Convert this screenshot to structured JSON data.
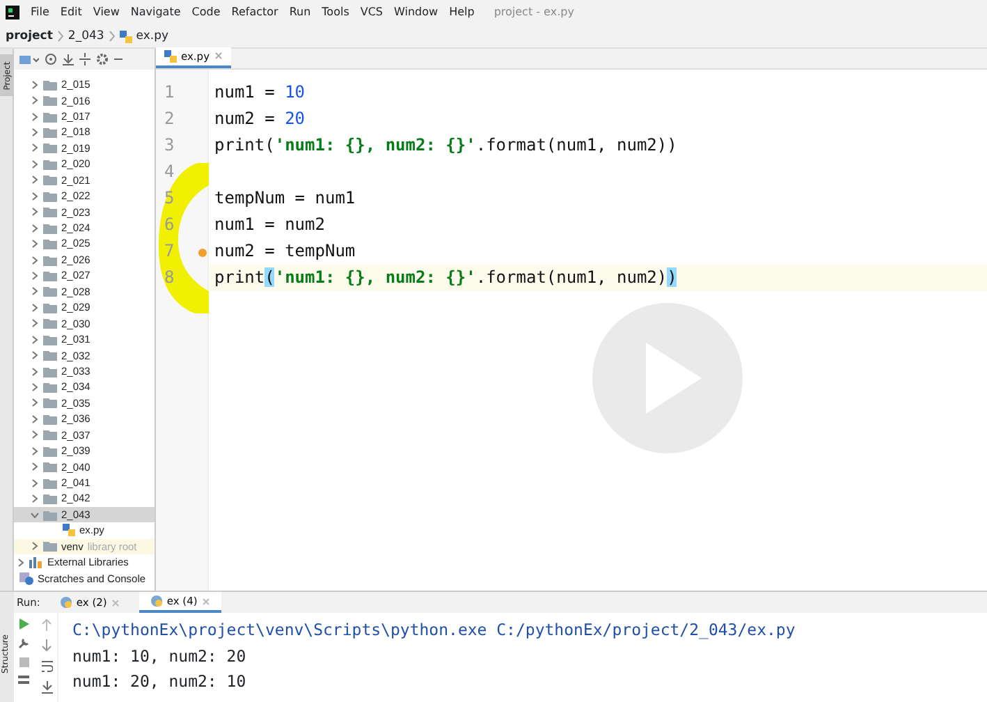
{
  "window": {
    "title": "project - ex.py"
  },
  "menu": [
    "File",
    "Edit",
    "View",
    "Navigate",
    "Code",
    "Refactor",
    "Run",
    "Tools",
    "VCS",
    "Window",
    "Help"
  ],
  "breadcrumbs": [
    {
      "label": "project",
      "kind": "project"
    },
    {
      "label": "2_043",
      "kind": "folder"
    },
    {
      "label": "ex.py",
      "kind": "file"
    }
  ],
  "side_stripe": {
    "label": "Project"
  },
  "tree": [
    {
      "label": "2_015",
      "kind": "folder",
      "expanded": false,
      "selected": false
    },
    {
      "label": "2_016",
      "kind": "folder",
      "expanded": false,
      "selected": false
    },
    {
      "label": "2_017",
      "kind": "folder",
      "expanded": false,
      "selected": false
    },
    {
      "label": "2_018",
      "kind": "folder",
      "expanded": false,
      "selected": false
    },
    {
      "label": "2_019",
      "kind": "folder",
      "expanded": false,
      "selected": false
    },
    {
      "label": "2_020",
      "kind": "folder",
      "expanded": false,
      "selected": false
    },
    {
      "label": "2_021",
      "kind": "folder",
      "expanded": false,
      "selected": false
    },
    {
      "label": "2_022",
      "kind": "folder",
      "expanded": false,
      "selected": false
    },
    {
      "label": "2_023",
      "kind": "folder",
      "expanded": false,
      "selected": false
    },
    {
      "label": "2_024",
      "kind": "folder",
      "expanded": false,
      "selected": false
    },
    {
      "label": "2_025",
      "kind": "folder",
      "expanded": false,
      "selected": false
    },
    {
      "label": "2_026",
      "kind": "folder",
      "expanded": false,
      "selected": false
    },
    {
      "label": "2_027",
      "kind": "folder",
      "expanded": false,
      "selected": false
    },
    {
      "label": "2_028",
      "kind": "folder",
      "expanded": false,
      "selected": false
    },
    {
      "label": "2_029",
      "kind": "folder",
      "expanded": false,
      "selected": false
    },
    {
      "label": "2_030",
      "kind": "folder",
      "expanded": false,
      "selected": false
    },
    {
      "label": "2_031",
      "kind": "folder",
      "expanded": false,
      "selected": false
    },
    {
      "label": "2_032",
      "kind": "folder",
      "expanded": false,
      "selected": false
    },
    {
      "label": "2_033",
      "kind": "folder",
      "expanded": false,
      "selected": false
    },
    {
      "label": "2_034",
      "kind": "folder",
      "expanded": false,
      "selected": false
    },
    {
      "label": "2_035",
      "kind": "folder",
      "expanded": false,
      "selected": false
    },
    {
      "label": "2_036",
      "kind": "folder",
      "expanded": false,
      "selected": false
    },
    {
      "label": "2_037",
      "kind": "folder",
      "expanded": false,
      "selected": false
    },
    {
      "label": "2_039",
      "kind": "folder",
      "expanded": false,
      "selected": false
    },
    {
      "label": "2_040",
      "kind": "folder",
      "expanded": false,
      "selected": false
    },
    {
      "label": "2_041",
      "kind": "folder",
      "expanded": false,
      "selected": false
    },
    {
      "label": "2_042",
      "kind": "folder",
      "expanded": false,
      "selected": false
    },
    {
      "label": "2_043",
      "kind": "folder",
      "expanded": true,
      "selected": true,
      "children": [
        {
          "label": "ex.py",
          "kind": "file",
          "selected": false
        }
      ]
    },
    {
      "label": "venv",
      "note": "library root",
      "kind": "folder",
      "expanded": false,
      "selected": false
    },
    {
      "label": "External Libraries",
      "kind": "library",
      "expanded": false,
      "selected": false,
      "outer": true
    },
    {
      "label": "Scratches and Console",
      "kind": "scratches",
      "selected": false,
      "outer": true
    }
  ],
  "editor": {
    "tabs": [
      {
        "label": "ex.py",
        "selected": true
      }
    ],
    "lines": [
      {
        "number": "1",
        "current": false,
        "tokens": [
          {
            "text": "num1 = ",
            "kind": "plain"
          },
          {
            "text": "10",
            "kind": "number"
          }
        ]
      },
      {
        "number": "2",
        "current": false,
        "tokens": [
          {
            "text": "num2 = ",
            "kind": "plain"
          },
          {
            "text": "20",
            "kind": "number"
          }
        ]
      },
      {
        "number": "3",
        "current": false,
        "tokens": [
          {
            "text": "print(",
            "kind": "plain"
          },
          {
            "text": "'num1: {}, num2: {}'",
            "kind": "string"
          },
          {
            "text": ".format(num1, num2))",
            "kind": "plain"
          }
        ]
      },
      {
        "number": "4",
        "current": false
      },
      {
        "number": "5",
        "current": false,
        "tokens": [
          {
            "text": "tempNum = num1",
            "kind": "plain"
          }
        ]
      },
      {
        "number": "6",
        "current": false,
        "tokens": [
          {
            "text": "num1 = num2",
            "kind": "plain"
          }
        ]
      },
      {
        "number": "7",
        "current": false,
        "tokens": [
          {
            "text": "num2 = tempNum",
            "kind": "plain"
          }
        ]
      },
      {
        "number": "8",
        "current": true,
        "tokens": [
          {
            "text": "print",
            "kind": "plain"
          },
          {
            "text": "(",
            "kind": "brace"
          },
          {
            "text": "'num1: {}, num2: {}'",
            "kind": "string"
          },
          {
            "text": ".format(num1, num2)",
            "kind": "plain"
          },
          {
            "text": ")",
            "kind": "brace"
          }
        ]
      }
    ]
  },
  "run": {
    "label": "Run:",
    "tabs": [
      {
        "label": "ex (2)",
        "selected": false
      },
      {
        "label": "ex (4)",
        "selected": true
      }
    ],
    "output": [
      "C:\\pythonEx\\project\\venv\\Scripts\\python.exe C:/pythonEx/project/2_043/ex.py",
      "num1: 10, num2: 20",
      "num1: 20, num2: 10"
    ],
    "side_label": "Structure"
  }
}
